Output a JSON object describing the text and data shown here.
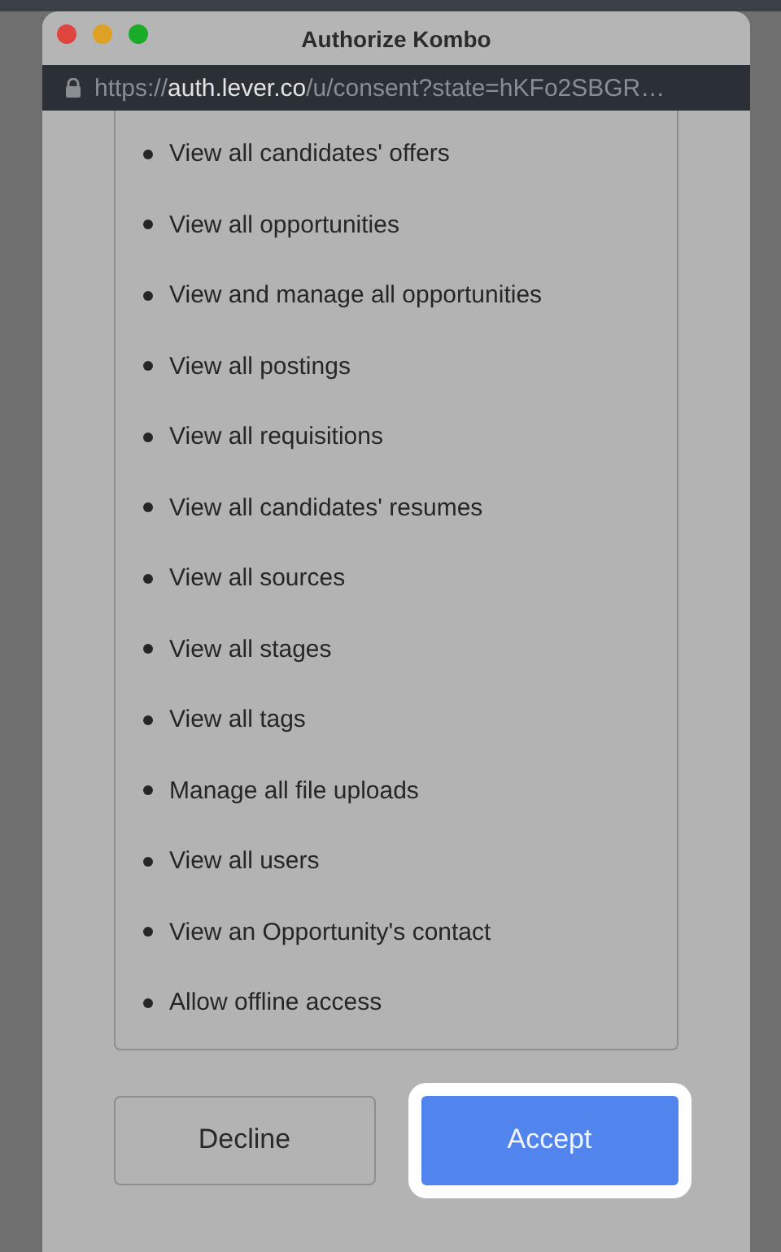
{
  "window": {
    "title": "Authorize Kombo"
  },
  "address_bar": {
    "scheme": "https://",
    "host": "auth.lever.co",
    "path": "/u/consent?state=hKFo2SBGR…"
  },
  "permissions": [
    "View all candidates' offers",
    "View all opportunities",
    "View and manage all opportunities",
    "View all postings",
    "View all requisitions",
    "View all candidates' resumes",
    "View all sources",
    "View all stages",
    "View all tags",
    "Manage all file uploads",
    "View all users",
    "View an Opportunity's contact",
    "Allow offline access"
  ],
  "buttons": [
    {
      "label": "Decline",
      "kind": "secondary",
      "highlighted": false
    },
    {
      "label": "Accept",
      "kind": "primary",
      "highlighted": true
    }
  ]
}
